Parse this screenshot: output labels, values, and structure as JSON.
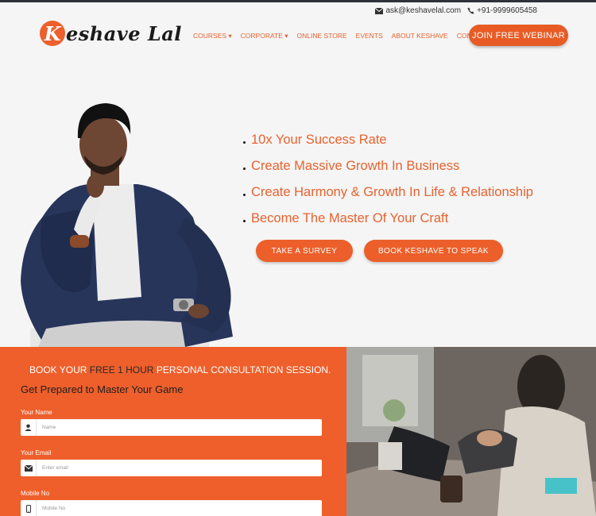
{
  "topbar": {
    "email": "ask@keshavelal.com",
    "phone": "+91-9999605458"
  },
  "logo": {
    "initial": "K",
    "rest": "eshave Lal"
  },
  "nav": {
    "items": [
      "COURSES ▾",
      "CORPORATE ▾",
      "ONLINE STORE",
      "EVENTS",
      "ABOUT KESHAVE",
      "CONTACT"
    ],
    "webinar_button": "JOIN FREE WEBINAR"
  },
  "hero": {
    "bullets": [
      "10x Your Success Rate",
      "Create Massive Growth In Business",
      "Create Harmony & Growth In Life & Relationship",
      "Become The Master Of Your Craft"
    ],
    "survey_button": "TAKE A SURVEY",
    "speak_button": "BOOK KESHAVE TO SPEAK"
  },
  "form": {
    "heading_pre": "BOOK YOUR ",
    "heading_highlight": "FREE 1 HOUR",
    "heading_post": " PERSONAL CONSULTATION SESSION.",
    "subheading": "Get Prepared to Master Your Game",
    "name_label": "Your Name",
    "name_placeholder": "Name",
    "email_label": "Your Email",
    "email_placeholder": "Enter email",
    "mobile_label": "Mobile No",
    "mobile_placeholder": "Mobile No"
  },
  "colors": {
    "accent": "#e8622e",
    "panel": "#ee5f2b"
  }
}
